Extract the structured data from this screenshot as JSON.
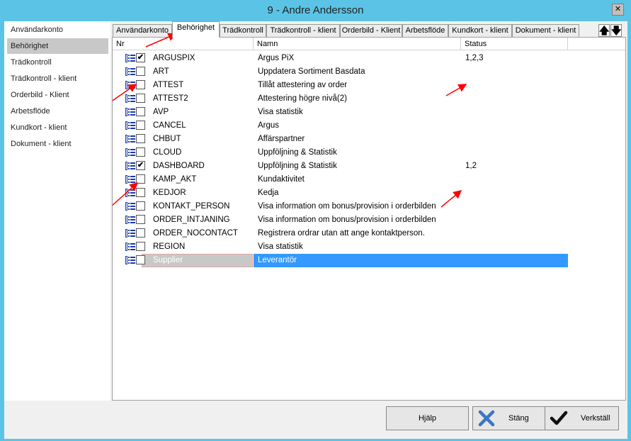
{
  "window": {
    "title": "9 - Andre Andersson",
    "close_label": "✕"
  },
  "sidebar": {
    "items": [
      {
        "label": "Användarkonto"
      },
      {
        "label": "Behörighet",
        "active": true
      },
      {
        "label": "Trädkontroll"
      },
      {
        "label": "Trädkontroll - klient"
      },
      {
        "label": "Orderbild - Klient"
      },
      {
        "label": "Arbetsflöde"
      },
      {
        "label": "Kundkort - klient"
      },
      {
        "label": "Dokument - klient"
      }
    ]
  },
  "tabs": [
    {
      "label": "Användarkonto"
    },
    {
      "label": "Behörighet",
      "active": true
    },
    {
      "label": "Trädkontroll"
    },
    {
      "label": "Trädkontroll - klient"
    },
    {
      "label": "Orderbild - Klient"
    },
    {
      "label": "Arbetsflöde"
    },
    {
      "label": "Kundkort - klient"
    },
    {
      "label": "Dokument - klient"
    }
  ],
  "tab_nav": {
    "up_label": "🡅",
    "down_label": "🡇"
  },
  "grid": {
    "columns": {
      "nr": "Nr",
      "namn": "Namn",
      "status": "Status"
    },
    "rows": [
      {
        "nr": "ARGUSPIX",
        "namn": "Argus PiX",
        "status": "1,2,3",
        "checked": true
      },
      {
        "nr": "ART",
        "namn": "Uppdatera Sortiment Basdata",
        "status": "",
        "checked": false
      },
      {
        "nr": "ATTEST",
        "namn": "Tillåt attestering av order",
        "status": "",
        "checked": false
      },
      {
        "nr": "ATTEST2",
        "namn": "Attestering högre nivå(2)",
        "status": "",
        "checked": false
      },
      {
        "nr": "AVP",
        "namn": "Visa statistik",
        "status": "",
        "checked": false
      },
      {
        "nr": "CANCEL",
        "namn": "Argus",
        "status": "",
        "checked": false
      },
      {
        "nr": "CHBUT",
        "namn": "Affärspartner",
        "status": "",
        "checked": false
      },
      {
        "nr": "CLOUD",
        "namn": "Uppföljning & Statistik",
        "status": "",
        "checked": false
      },
      {
        "nr": "DASHBOARD",
        "namn": "Uppföljning & Statistik",
        "status": "1,2",
        "checked": true
      },
      {
        "nr": "KAMP_AKT",
        "namn": "Kundaktivitet",
        "status": "",
        "checked": false
      },
      {
        "nr": "KEDJOR",
        "namn": "Kedja",
        "status": "",
        "checked": false
      },
      {
        "nr": "KONTAKT_PERSON",
        "namn": "Visa information om bonus/provision i orderbilden",
        "status": "",
        "checked": false
      },
      {
        "nr": "ORDER_INTJANING",
        "namn": "Visa information om bonus/provision i orderbilden",
        "status": "",
        "checked": false
      },
      {
        "nr": "ORDER_NOCONTACT",
        "namn": "Registrera ordrar utan att ange kontaktperson.",
        "status": "",
        "checked": false
      },
      {
        "nr": "REGION",
        "namn": "Visa statistik",
        "status": "",
        "checked": false
      },
      {
        "nr": "Supplier",
        "namn": "Leverantör",
        "status": "",
        "checked": false,
        "selected": true
      }
    ]
  },
  "footer": {
    "help_label": "Hjälp",
    "close_label": "Stäng",
    "apply_label": "Verkställ"
  },
  "colors": {
    "titlebar": "#5bc4e6",
    "selection": "#3399ff",
    "annotation_arrow": "#ff0000"
  }
}
